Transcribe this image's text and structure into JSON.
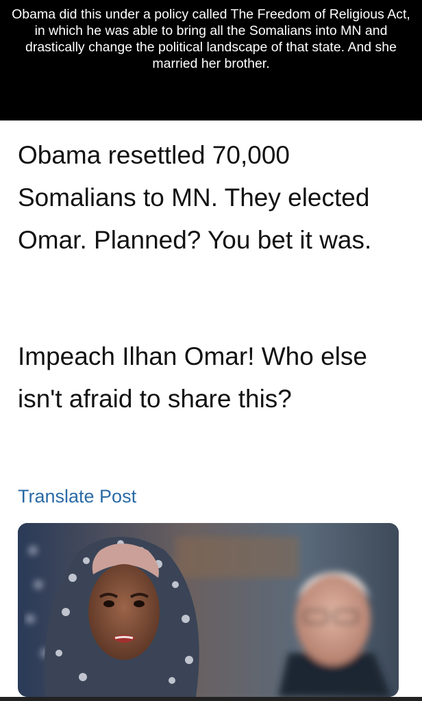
{
  "caption": {
    "text": "Obama did this under a policy called The Freedom of Religious Act, in which he was able to bring all the Somalians into MN and drastically change the political landscape of that state.  And she married her brother."
  },
  "post": {
    "paragraph1": "Obama resettled 70,000 Somalians to MN. They elected Omar. Planned? You bet it was.",
    "paragraph2": "Impeach Ilhan Omar! Who else isn't afraid to share this?",
    "translate_label": "Translate Post"
  },
  "colors": {
    "caption_background": "#000000",
    "caption_text": "#ffffff",
    "post_text": "#111111",
    "translate_link": "#2a6aa6"
  },
  "photo": {
    "icon": "photo-icon"
  }
}
